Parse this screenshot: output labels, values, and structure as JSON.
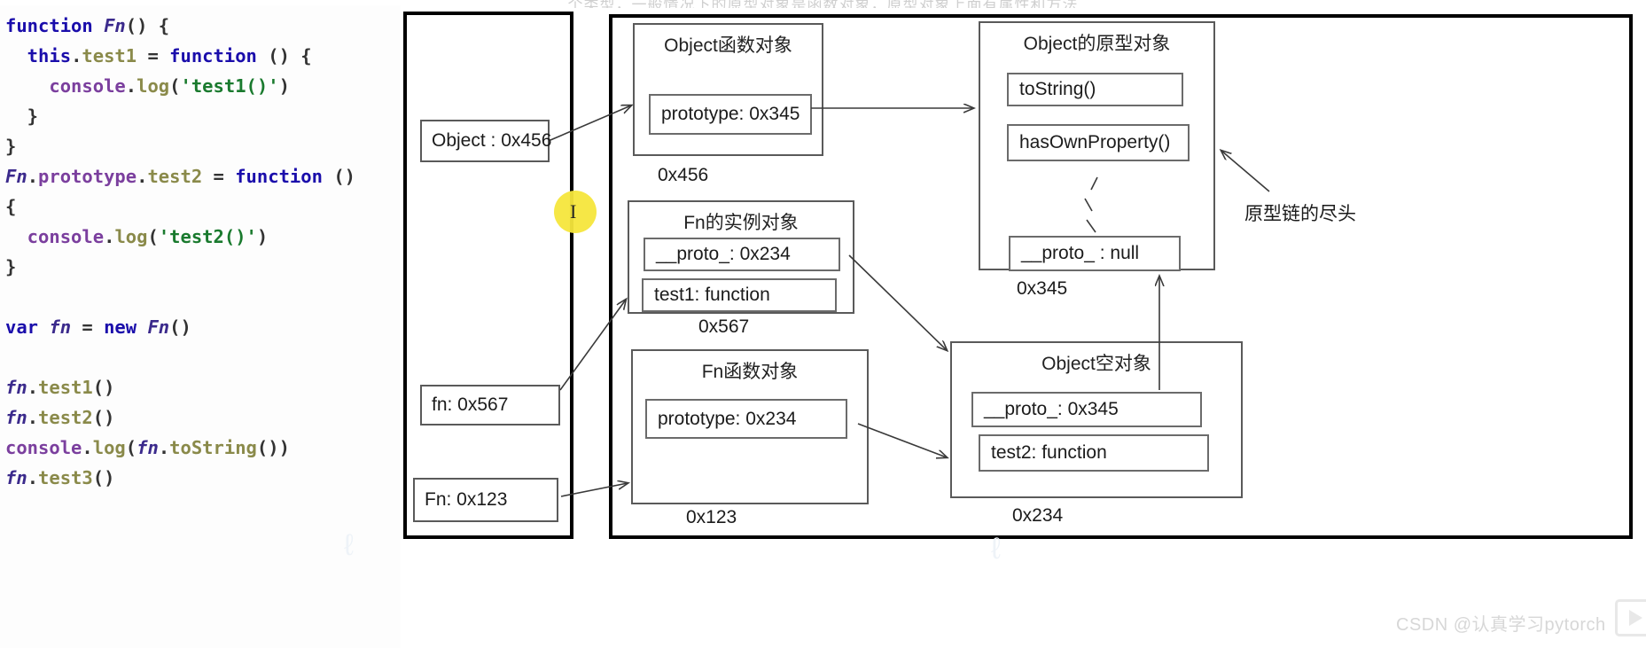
{
  "top_strip": {
    "clipped_text": "个类型，一般情况下的原型对象是函数对象，原型对象上面有属性和方法"
  },
  "code": {
    "lines": [
      [
        {
          "t": "function ",
          "c": "kw"
        },
        {
          "t": "Fn",
          "c": "fnname"
        },
        {
          "t": "() {",
          "c": "punc"
        }
      ],
      [
        {
          "t": "  this",
          "c": "kw"
        },
        {
          "t": ".",
          "c": "punc"
        },
        {
          "t": "test1",
          "c": "prop"
        },
        {
          "t": " = ",
          "c": "punc"
        },
        {
          "t": "function ",
          "c": "kw"
        },
        {
          "t": "() {",
          "c": "punc"
        }
      ],
      [
        {
          "t": "    console",
          "c": "obj"
        },
        {
          "t": ".",
          "c": "punc"
        },
        {
          "t": "log",
          "c": "prop"
        },
        {
          "t": "(",
          "c": "punc"
        },
        {
          "t": "'test1()'",
          "c": "str"
        },
        {
          "t": ")",
          "c": "punc"
        }
      ],
      [
        {
          "t": "  }",
          "c": "brace"
        }
      ],
      [
        {
          "t": "}",
          "c": "brace"
        }
      ],
      [
        {
          "t": "Fn",
          "c": "fnname"
        },
        {
          "t": ".",
          "c": "punc"
        },
        {
          "t": "prototype",
          "c": "obj"
        },
        {
          "t": ".",
          "c": "punc"
        },
        {
          "t": "test2",
          "c": "prop"
        },
        {
          "t": " = ",
          "c": "punc"
        },
        {
          "t": "function ",
          "c": "kw"
        },
        {
          "t": "()",
          "c": "punc"
        }
      ],
      [
        {
          "t": "{",
          "c": "brace"
        }
      ],
      [
        {
          "t": "  console",
          "c": "obj"
        },
        {
          "t": ".",
          "c": "punc"
        },
        {
          "t": "log",
          "c": "prop"
        },
        {
          "t": "(",
          "c": "punc"
        },
        {
          "t": "'test2()'",
          "c": "str"
        },
        {
          "t": ")",
          "c": "punc"
        }
      ],
      [
        {
          "t": "}",
          "c": "brace"
        }
      ],
      [
        {
          "t": "",
          "c": "punc"
        }
      ],
      [
        {
          "t": "var ",
          "c": "kw"
        },
        {
          "t": "fn",
          "c": "fnname"
        },
        {
          "t": " = ",
          "c": "punc"
        },
        {
          "t": "new ",
          "c": "kw"
        },
        {
          "t": "Fn",
          "c": "fnname"
        },
        {
          "t": "()",
          "c": "punc"
        }
      ],
      [
        {
          "t": "",
          "c": "punc"
        }
      ],
      [
        {
          "t": "fn",
          "c": "fnname"
        },
        {
          "t": ".",
          "c": "punc"
        },
        {
          "t": "test1",
          "c": "prop"
        },
        {
          "t": "()",
          "c": "punc"
        }
      ],
      [
        {
          "t": "fn",
          "c": "fnname"
        },
        {
          "t": ".",
          "c": "punc"
        },
        {
          "t": "test2",
          "c": "prop"
        },
        {
          "t": "()",
          "c": "punc"
        }
      ],
      [
        {
          "t": "console",
          "c": "obj"
        },
        {
          "t": ".",
          "c": "punc"
        },
        {
          "t": "log",
          "c": "prop"
        },
        {
          "t": "(",
          "c": "punc"
        },
        {
          "t": "fn",
          "c": "fnname"
        },
        {
          "t": ".",
          "c": "punc"
        },
        {
          "t": "toString",
          "c": "prop"
        },
        {
          "t": "())",
          "c": "punc"
        }
      ],
      [
        {
          "t": "fn",
          "c": "fnname"
        },
        {
          "t": ".",
          "c": "punc"
        },
        {
          "t": "test3",
          "c": "prop"
        },
        {
          "t": "()",
          "c": "punc"
        }
      ]
    ]
  },
  "diagram": {
    "variables": [
      {
        "label": "Object : 0x456"
      },
      {
        "label": "fn: 0x567"
      },
      {
        "label": "Fn: 0x123"
      }
    ],
    "objects": [
      {
        "id": "object-function-object",
        "title": "Object函数对象",
        "address": "0x456",
        "slots": [
          "prototype: 0x345"
        ]
      },
      {
        "id": "object-prototype-object",
        "title": "Object的原型对象",
        "address": "0x345",
        "slots": [
          "toString()",
          "hasOwnProperty()",
          "__proto_ : null"
        ]
      },
      {
        "id": "fn-instance-object",
        "title": "Fn的实例对象",
        "address": "0x567",
        "slots": [
          "__proto_: 0x234",
          "test1: function"
        ]
      },
      {
        "id": "fn-function-object",
        "title": "Fn函数对象",
        "address": "0x123",
        "slots": [
          "prototype: 0x234"
        ]
      },
      {
        "id": "object-empty-object",
        "title": "Object空对象",
        "address": "0x234",
        "slots": [
          "__proto_: 0x345",
          "test2: function"
        ]
      }
    ],
    "annotations": [
      {
        "id": "end-of-prototype-chain",
        "text": "原型链的尽头"
      }
    ]
  },
  "watermark": {
    "text": "CSDN @认真学习pytorch"
  }
}
